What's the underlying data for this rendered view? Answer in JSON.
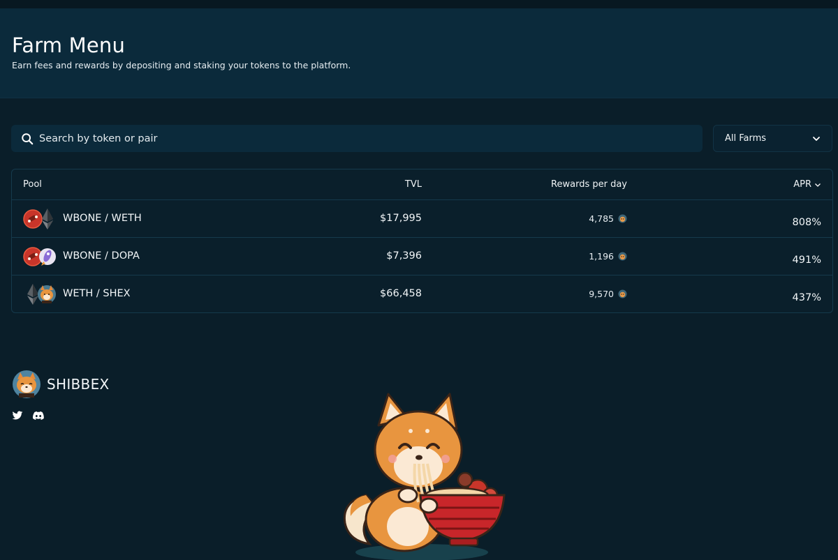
{
  "header": {
    "title": "Farm Menu",
    "subtitle": "Earn fees and rewards by depositing and staking your tokens to the platform."
  },
  "search": {
    "placeholder": "Search by token or pair",
    "value": ""
  },
  "filter": {
    "selected": "All Farms"
  },
  "table": {
    "columns": {
      "pool": "Pool",
      "tvl": "TVL",
      "rewards": "Rewards per day",
      "apr": "APR"
    },
    "rows": [
      {
        "pair": "WBONE / WETH",
        "tvl": "$17,995",
        "rewards": "4,785",
        "apr": "808%",
        "icons": [
          "bone-token-icon",
          "ethereum-icon"
        ]
      },
      {
        "pair": "WBONE / DOPA",
        "tvl": "$7,396",
        "rewards": "1,196",
        "apr": "491%",
        "icons": [
          "bone-token-icon",
          "dopa-rocket-icon"
        ]
      },
      {
        "pair": "WETH / SHEX",
        "tvl": "$66,458",
        "rewards": "9,570",
        "apr": "437%",
        "icons": [
          "ethereum-icon",
          "shibbex-token-icon"
        ]
      }
    ]
  },
  "footer": {
    "brand": "SHIBBEX",
    "socials": [
      "twitter-icon",
      "discord-icon"
    ]
  },
  "colors": {
    "background": "#0a1e29",
    "hero": "#0b2a3b",
    "border": "#153a4c",
    "text": "#f2f6f8",
    "accent_orange": "#f0a24a"
  }
}
